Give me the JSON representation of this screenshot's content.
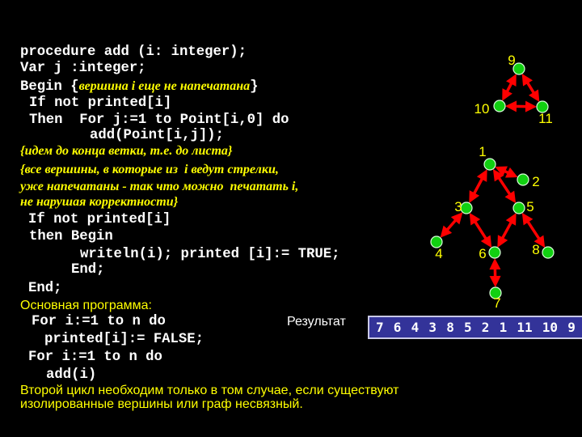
{
  "procedure": {
    "lines": [
      "procedure add (i: integer);",
      "Var j :integer;"
    ],
    "begin_line": {
      "keyword": "Begin ",
      "open": "{",
      "comment": "вершина i еще не напечатана",
      "close": "}"
    },
    "body": [
      "If not printed[i]",
      "Then  For j:=1 to Point[i,0] do",
      "add(Point[i,j]);"
    ],
    "comments": [
      "{идем до конца ветки, т.е. до листа}",
      "{все вершины, в которые из  i ведут стрелки,",
      "уже напечатаны - так что можно  печатать i,",
      "не нарушая корректности}"
    ],
    "tail": [
      "If not printed[i]",
      "then Begin",
      "writeln(i); printed [i]:= TRUE;",
      "End;",
      "End;"
    ]
  },
  "main": {
    "heading": "Основная программа:",
    "lines": [
      "For i:=1 to n do",
      "printed[i]:= FALSE;",
      "For i:=1 to n do",
      "add(i)"
    ]
  },
  "note": {
    "line1": "Второй цикл необходим только в том случае, если существуют",
    "line2": "изолированные вершины или граф несвязный."
  },
  "result": {
    "label": "Результат",
    "sequence": [
      "7",
      "6",
      "4",
      "3",
      "8",
      "5",
      "2",
      "1",
      "11",
      "10",
      "9"
    ]
  },
  "graph": {
    "colors": {
      "node": "#11d011",
      "node_outline": "#d8ffd8",
      "edge": "#ff0000",
      "label": "#ffff00"
    },
    "nodes": [
      "1",
      "2",
      "3",
      "4",
      "5",
      "6",
      "7",
      "8",
      "9",
      "10",
      "11"
    ],
    "edges": [
      [
        "9",
        "10"
      ],
      [
        "9",
        "11"
      ],
      [
        "10",
        "11"
      ],
      [
        "1",
        "2"
      ],
      [
        "1",
        "3"
      ],
      [
        "1",
        "5"
      ],
      [
        "3",
        "4"
      ],
      [
        "3",
        "6"
      ],
      [
        "5",
        "6"
      ],
      [
        "5",
        "8"
      ],
      [
        "6",
        "7"
      ]
    ],
    "edge_style": "bidirectional-arrow"
  }
}
